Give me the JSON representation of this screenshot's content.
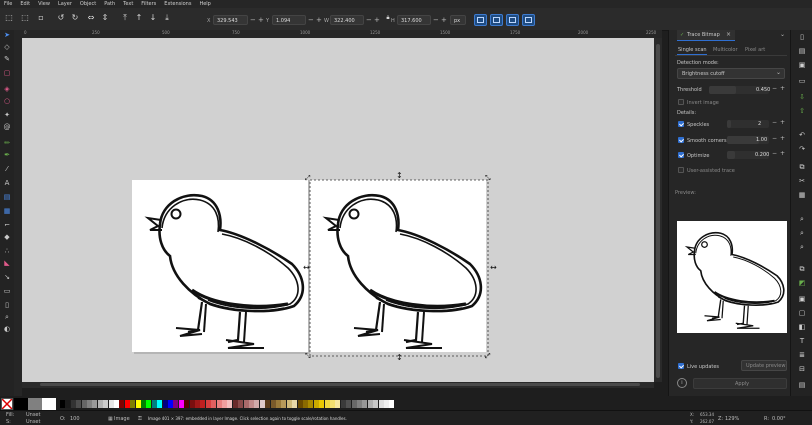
{
  "menu": [
    "File",
    "Edit",
    "View",
    "Layer",
    "Object",
    "Path",
    "Text",
    "Filters",
    "Extensions",
    "Help"
  ],
  "toolbar": {
    "x_label": "X",
    "x_value": "329.543",
    "y_label": "Y",
    "y_value": "1.094",
    "w_label": "W",
    "w_value": "322.400",
    "h_label": "H",
    "h_value": "317.600",
    "unit": "px",
    "plus": "+",
    "minus": "−"
  },
  "ruler": {
    "top_ticks": [
      "0",
      "250",
      "500",
      "750",
      "1000",
      "1250",
      "1500",
      "1750",
      "2000",
      "2250"
    ]
  },
  "panel": {
    "tab_title": "Trace Bitmap",
    "subtabs": [
      "Single scan",
      "Multicolor",
      "Pixel art"
    ],
    "detection_mode_label": "Detection mode:",
    "detection_mode_value": "Brightness cutoff",
    "threshold_label": "Threshold",
    "threshold_value": "0.450",
    "invert_label": "Invert image",
    "details_label": "Details:",
    "speckles_label": "Speckles",
    "speckles_value": "2",
    "smooth_label": "Smooth corners",
    "smooth_value": "1.00",
    "optimize_label": "Optimize",
    "optimize_value": "0.200",
    "user_assisted_label": "User-assisted trace",
    "preview_label": "Preview:",
    "live_updates_label": "Live updates",
    "update_preview_label": "Update preview",
    "apply_label": "Apply",
    "plus": "+",
    "minus": "−"
  },
  "status": {
    "fill_label": "Fill:",
    "fill_value": "Unset",
    "stroke_label": "S:",
    "stroke_value": "Unset",
    "opacity_label": "O:",
    "opacity_value": "100",
    "layer_value": "Image",
    "message": "Image 401 × 397: embedded in layer Image. Click selection again to toggle scale/rotation handles.",
    "x_label": "X:",
    "x_value": "653.34",
    "y_label": "Y:",
    "y_value": "262.07",
    "zoom_label": "Z:",
    "zoom_value": "129%",
    "rot_label": "R:",
    "rot_value": "0.00°"
  },
  "colors": {
    "accent": "#2f6fd1",
    "canvas_bg": "#d1d1d1",
    "palette": [
      "#000000",
      "#1a1a1a",
      "#333333",
      "#4d4d4d",
      "#666666",
      "#808080",
      "#999999",
      "#b3b3b3",
      "#cccccc",
      "#e6e6e6",
      "#ffffff",
      "#800000",
      "#ff0000",
      "#808000",
      "#ffff00",
      "#008000",
      "#00ff00",
      "#008080",
      "#00ffff",
      "#000080",
      "#0000ff",
      "#800080",
      "#ff00ff",
      "#5a0000",
      "#7a0f0f",
      "#a01818",
      "#c02020",
      "#d84040",
      "#e06060",
      "#e88080",
      "#f0a0a0",
      "#f4c0c0",
      "#6a2a2a",
      "#8a4a4a",
      "#aa6a6a",
      "#c08a8a",
      "#d0aaaa",
      "#e0caca",
      "#5a3a1a",
      "#7a5a2a",
      "#9a7a3a",
      "#b89a5a",
      "#d0ba7a",
      "#e8d8a8",
      "#6a4a00",
      "#8a6a00",
      "#aa8a00",
      "#caaa00",
      "#eac800",
      "#f0d840",
      "#f4e070",
      "#f8e8a0",
      "#3a3a3a",
      "#505050",
      "#686868",
      "#808080",
      "#989898",
      "#b0b0b0",
      "#c8c8c8",
      "#e0e0e0",
      "#f0f0f0",
      "#ffffff"
    ]
  }
}
